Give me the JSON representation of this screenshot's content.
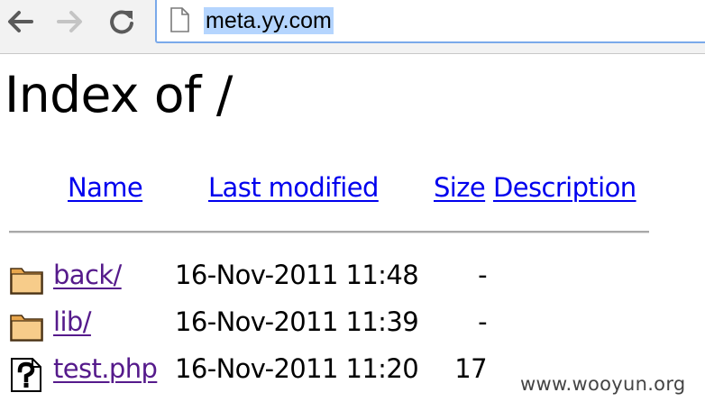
{
  "browser": {
    "back_icon": "arrow-left-icon",
    "forward_icon": "arrow-right-icon",
    "reload_icon": "reload-icon",
    "page_icon": "document-icon",
    "address": "meta.yy.com",
    "selection_color": "#b5d5fe",
    "focus_color": "#7aa9ea"
  },
  "page": {
    "title": "Index of /",
    "columns": {
      "name": "Name",
      "last_modified": "Last modified",
      "size": "Size",
      "description": "Description"
    },
    "entries": [
      {
        "icon": "folder-icon",
        "name": "back/",
        "modified": "16-Nov-2011 11:48",
        "size": "-"
      },
      {
        "icon": "folder-icon",
        "name": "lib/",
        "modified": "16-Nov-2011 11:39",
        "size": "-"
      },
      {
        "icon": "unknown-file-icon",
        "name": "test.php",
        "modified": "16-Nov-2011 11:20",
        "size": "17"
      }
    ],
    "link_color": "#0000ee",
    "visited_color": "#551a8b"
  },
  "watermark": "www.wooyun.org"
}
